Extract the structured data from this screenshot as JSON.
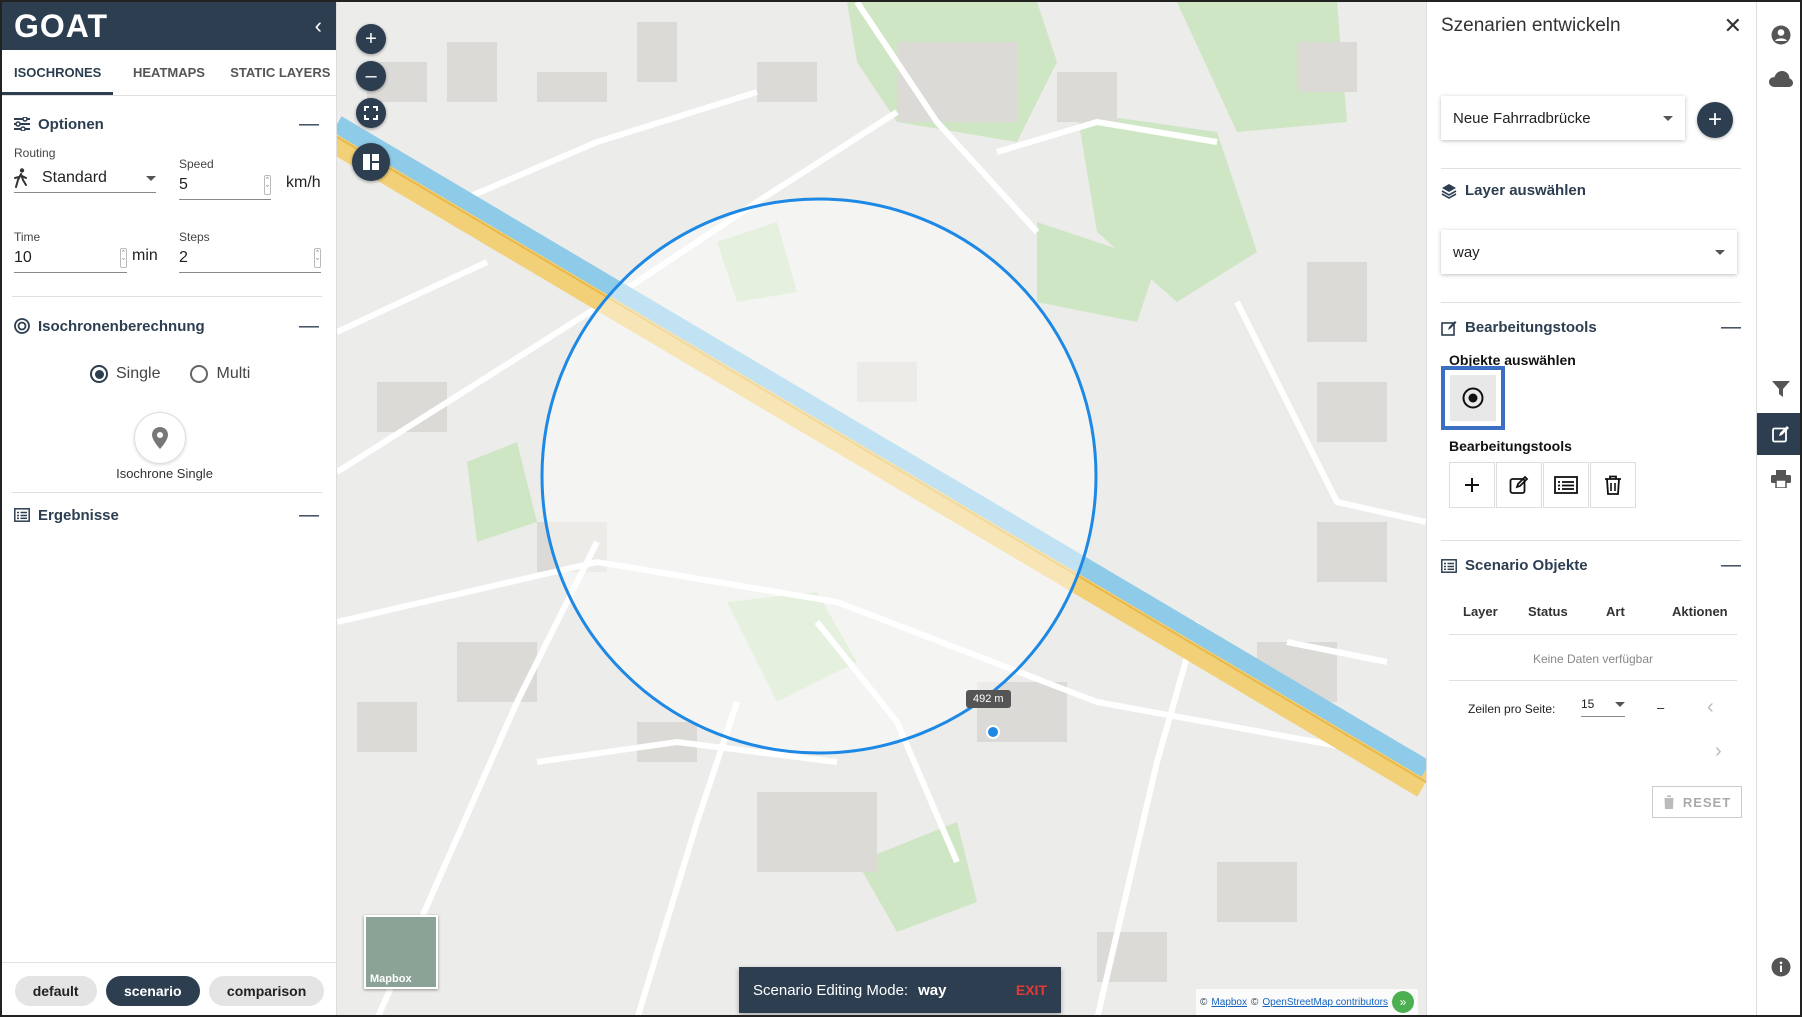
{
  "app": {
    "logo": "GOAT"
  },
  "left": {
    "tabs": [
      "ISOCHRONES",
      "HEATMAPS",
      "STATIC LAYERS"
    ],
    "options": {
      "title": "Optionen",
      "routing_label": "Routing",
      "routing_value": "Standard",
      "speed_label": "Speed",
      "speed_value": "5",
      "speed_unit": "km/h",
      "time_label": "Time",
      "time_value": "10",
      "time_unit": "min",
      "steps_label": "Steps",
      "steps_value": "2"
    },
    "calc": {
      "title": "Isochronenberechnung",
      "single": "Single",
      "multi": "Multi",
      "selected": "Single",
      "button_label": "Isochrone Single"
    },
    "results": {
      "title": "Ergebnisse"
    },
    "modes": [
      "default",
      "scenario",
      "comparison"
    ],
    "active_mode": "scenario"
  },
  "map": {
    "distance_label": "492 m",
    "basemap_label": "Mapbox",
    "mode_bar": {
      "label": "Scenario Editing Mode:",
      "layer": "way",
      "exit": "EXIT"
    },
    "attribution": {
      "mapbox": "Mapbox",
      "osm": "OpenStreetMap contributors"
    }
  },
  "right": {
    "title": "Szenarien entwickeln",
    "scenario_select": "Neue Fahrradbrücke",
    "layer_section": "Layer auswählen",
    "layer_select": "way",
    "tools_section": "Bearbeitungstools",
    "select_objects_label": "Objekte auswählen",
    "edit_tools_label": "Bearbeitungstools",
    "objects_section": "Scenario Objekte",
    "table_headers": [
      "Layer",
      "Status",
      "Art",
      "Aktionen"
    ],
    "no_data": "Keine Daten verfügbar",
    "rows_per_page_label": "Zeilen pro Seite:",
    "rows_per_page": "15",
    "pagination_range": "–",
    "reset": "RESET"
  },
  "colors": {
    "primary": "#2c3e50",
    "isochrone": "#1e88e5",
    "exit": "#e53935",
    "highlight": "#3a6fc4",
    "river": "#8ecbe8",
    "highway": "#f2d078"
  }
}
